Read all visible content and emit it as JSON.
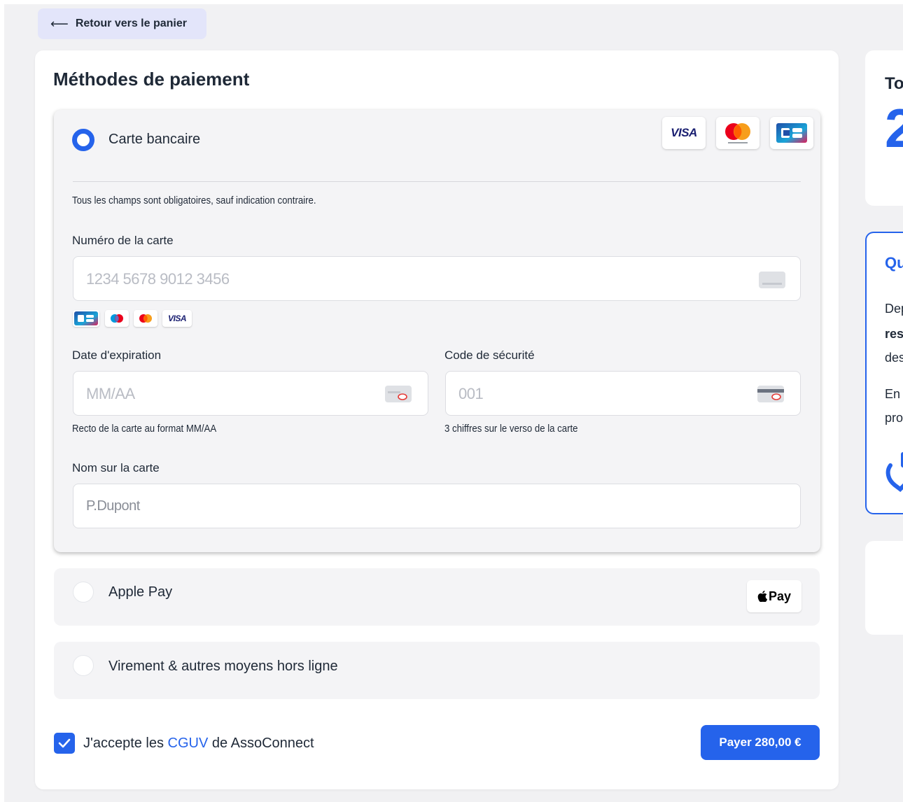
{
  "back_button": {
    "label": "Retour vers le panier",
    "icon": "arrow-left-icon"
  },
  "payment": {
    "title": "Méthodes de paiement",
    "card_option": {
      "label": "Carte bancaire",
      "selected": true,
      "brands": [
        "VISA",
        "Mastercard",
        "CB"
      ],
      "required_notice": "Tous les champs sont obligatoires, sauf indication contraire.",
      "card_number": {
        "label": "Numéro de la carte",
        "placeholder": "1234 5678 9012 3456",
        "accepted": [
          "CB",
          "Maestro",
          "Mastercard",
          "VISA"
        ]
      },
      "expiry": {
        "label": "Date d'expiration",
        "placeholder": "MM/AA",
        "hint": "Recto de la carte au format MM/AA"
      },
      "security_code": {
        "label": "Code de sécurité",
        "placeholder": "001",
        "hint": "3 chiffres sur le verso de la carte"
      },
      "name": {
        "label": "Nom sur la carte",
        "value": "P.Dupont"
      }
    },
    "apple_pay_option": {
      "label": "Apple Pay",
      "badge": "Pay",
      "selected": false
    },
    "offline_option": {
      "label": "Virement & autres moyens hors ligne",
      "selected": false
    },
    "terms": {
      "prefix": "J'accepte les ",
      "link": "CGUV",
      "suffix": " de AssoConnect",
      "checked": true
    },
    "pay_button": "Payer 280,00 €"
  },
  "sidebar": {
    "total_card": {
      "title_fragment": "To",
      "amount_fragment": "2"
    },
    "info_card": {
      "title_fragment": "Qu",
      "lines": [
        "Dep",
        "res",
        "des",
        "En p",
        "pro"
      ]
    }
  },
  "colors": {
    "accent": "#2563eb",
    "page_bg": "#f1f1f3",
    "back_button_bg": "#e3e5fa"
  }
}
